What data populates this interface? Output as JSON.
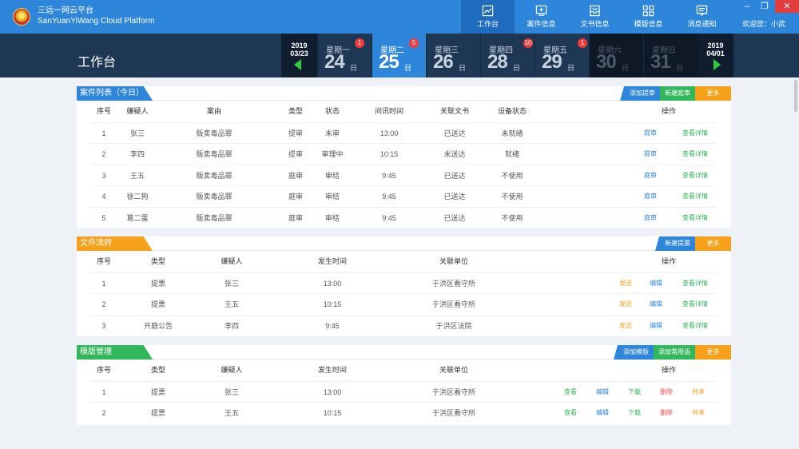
{
  "app": {
    "title_cn": "三远一网云平台",
    "title_en": "SanYuanYiWang Cloud Platform",
    "welcome": "欢迎您：小武"
  },
  "nav": [
    {
      "label": "工作台",
      "icon": "chart-icon",
      "active": true
    },
    {
      "label": "案件信息",
      "icon": "monitor-icon",
      "active": false
    },
    {
      "label": "文书信息",
      "icon": "inbox-icon",
      "active": false
    },
    {
      "label": "模版信息",
      "icon": "grid-icon",
      "active": false
    },
    {
      "label": "消息通知",
      "icon": "message-icon",
      "active": false
    }
  ],
  "page_title": "工作台",
  "week": {
    "prev": {
      "year": "2019",
      "date": "03/23"
    },
    "next": {
      "year": "2019",
      "date": "04/01"
    },
    "days": [
      {
        "name": "星期一",
        "num": "24",
        "ri": "日",
        "badge": "1",
        "state": "normal"
      },
      {
        "name": "星期二",
        "num": "25",
        "ri": "日",
        "badge": "5",
        "state": "active"
      },
      {
        "name": "星期三",
        "num": "26",
        "ri": "日",
        "badge": "",
        "state": "normal"
      },
      {
        "name": "星期四",
        "num": "28",
        "ri": "日",
        "badge": "10",
        "state": "normal"
      },
      {
        "name": "星期五",
        "num": "29",
        "ri": "日",
        "badge": "1",
        "state": "normal"
      },
      {
        "name": "星期六",
        "num": "30",
        "ri": "日",
        "badge": "",
        "state": "weekend"
      },
      {
        "name": "星期日",
        "num": "31",
        "ri": "日",
        "badge": "",
        "state": "weekend"
      }
    ]
  },
  "cases": {
    "title": "案件列表（今日）",
    "actions": [
      "添加提审",
      "新建庭审",
      "更多"
    ],
    "headers": [
      "序号",
      "嫌疑人",
      "案由",
      "类型",
      "状态",
      "问讯时间",
      "关联文书",
      "设备状态",
      "操作"
    ],
    "rows": [
      {
        "no": "1",
        "suspect": "张三",
        "cause": "贩卖毒品罪",
        "type": "提审",
        "status": "未审",
        "time": "13:00",
        "doc": "已送达",
        "device": "未就绪",
        "op1": "提审",
        "op2": "查看详情"
      },
      {
        "no": "2",
        "suspect": "李四",
        "cause": "贩卖毒品罪",
        "type": "提审",
        "status": "审理中",
        "time": "10:15",
        "doc": "未送达",
        "device": "就绪",
        "op1": "提审",
        "op2": "查看详情"
      },
      {
        "no": "3",
        "suspect": "王五",
        "cause": "贩卖毒品罪",
        "type": "庭审",
        "status": "审结",
        "time": "9:45",
        "doc": "已送达",
        "device": "不使用",
        "op1": "庭审",
        "op2": "查看详情"
      },
      {
        "no": "4",
        "suspect": "徐二狗",
        "cause": "贩卖毒品罪",
        "type": "庭审",
        "status": "审结",
        "time": "9:45",
        "doc": "已送达",
        "device": "不使用",
        "op1": "庭审",
        "op2": "查看详情"
      },
      {
        "no": "5",
        "suspect": "葛二蛋",
        "cause": "贩卖毒品罪",
        "type": "庭审",
        "status": "审结",
        "time": "9:45",
        "doc": "已送达",
        "device": "不使用",
        "op1": "庭审",
        "op2": "查看详情"
      }
    ]
  },
  "docs": {
    "title": "文件流转",
    "actions": [
      "新建提票",
      "更多"
    ],
    "headers": [
      "序号",
      "类型",
      "嫌疑人",
      "发生时间",
      "关联单位",
      "操作"
    ],
    "rows": [
      {
        "no": "1",
        "type": "提票",
        "suspect": "张三",
        "time": "13:00",
        "unit": "于洪区看守所",
        "op1": "发送",
        "op2": "编辑",
        "op3": "查看详情"
      },
      {
        "no": "2",
        "type": "提票",
        "suspect": "王五",
        "time": "10:15",
        "unit": "于洪区看守所",
        "op1": "发送",
        "op2": "编辑",
        "op3": "查看详情"
      },
      {
        "no": "3",
        "type": "开庭公告",
        "suspect": "李四",
        "time": "9:45",
        "unit": "于洪区法院",
        "op1": "发送",
        "op2": "编辑",
        "op3": "查看详情"
      }
    ]
  },
  "templates": {
    "title": "模版管理",
    "actions": [
      "添加模版",
      "添加常用语",
      "更多"
    ],
    "headers": [
      "序号",
      "类型",
      "嫌疑人",
      "发生时间",
      "关联单位",
      "操作"
    ],
    "rows": [
      {
        "no": "1",
        "type": "提票",
        "suspect": "张三",
        "time": "13:00",
        "unit": "于洪区看守所",
        "op1": "查看",
        "op2": "编辑",
        "op3": "下载",
        "op4": "删除",
        "op5": "共享"
      },
      {
        "no": "2",
        "type": "提票",
        "suspect": "王五",
        "time": "10:15",
        "unit": "于洪区看守所",
        "op1": "查看",
        "op2": "编辑",
        "op3": "下载",
        "op4": "删除",
        "op5": "共享"
      }
    ]
  }
}
